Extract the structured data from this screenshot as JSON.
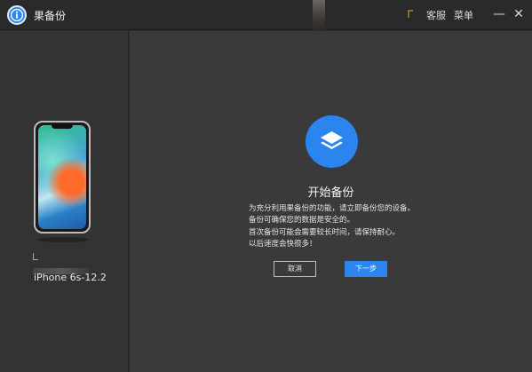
{
  "titlebar": {
    "app_title": "果备份",
    "service_label": "客服",
    "menu_label": "菜单",
    "minimize_glyph": "—",
    "close_glyph": "✕"
  },
  "sidebar": {
    "device_name": "iPhone 6s-12.2"
  },
  "main": {
    "heading": "开始备份",
    "description_lines": [
      "为充分利用果备份的功能，请立即备份您的设备。",
      "备份可确保您的数据是安全的。",
      "首次备份可能会需要较长时间，请保持耐心。",
      "以后速度会快很多！"
    ],
    "cancel_label": "取消",
    "next_label": "下一步"
  },
  "colors": {
    "accent": "#2c85ee",
    "background": "#3a3a3a",
    "sidebar": "#333333"
  },
  "icons": [
    "logo-info-icon",
    "layers-icon",
    "minimize-icon",
    "close-icon"
  ]
}
